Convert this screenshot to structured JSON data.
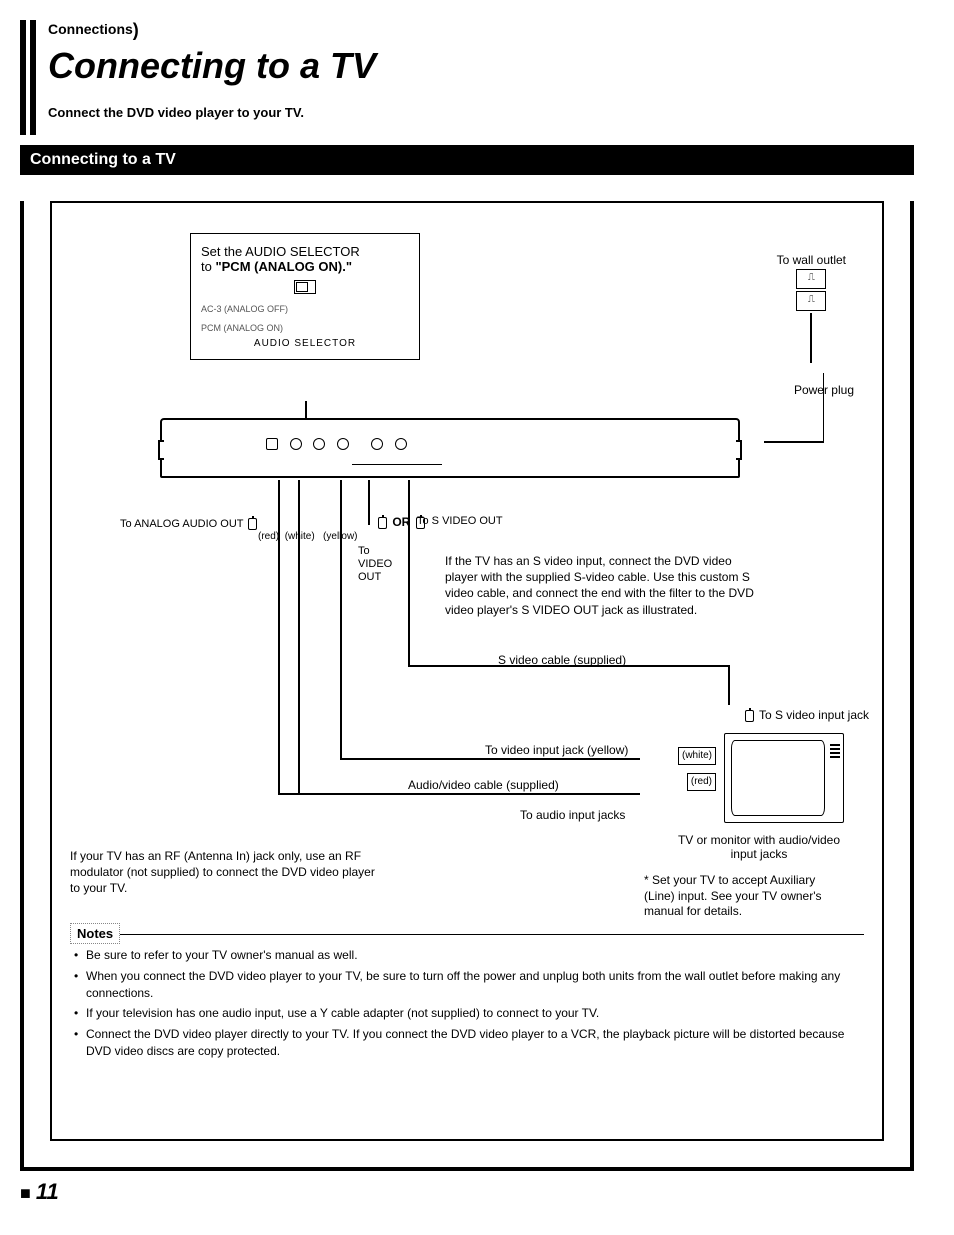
{
  "breadcrumb": "Connections",
  "title": "Connecting to a TV",
  "intro": "Connect the DVD video player to your TV.",
  "section_bar": "Connecting to a TV",
  "selector_box": {
    "line1": "Set the AUDIO SELECTOR",
    "line2_prefix": "to ",
    "line2_bold": "\"PCM (ANALOG ON).\"",
    "opt1": "AC-3 (ANALOG OFF)",
    "opt2": "PCM (ANALOG ON)",
    "label": "AUDIO SELECTOR"
  },
  "wall_outlet": "To wall outlet",
  "power_plug": "Power plug",
  "analog_out": "To ANALOG AUDIO OUT",
  "colors": {
    "red": "(red)",
    "white": "(white)",
    "yellow": "(yellow)"
  },
  "or": "OR",
  "svideo_out": "To S VIDEO OUT",
  "video_out": "To\nVIDEO\nOUT",
  "svideo_note": "If the TV has an S video input, connect the DVD video player with the supplied S-video cable. Use this custom S video cable, and connect the end with the filter to the DVD video player's S VIDEO OUT jack as illustrated.",
  "svideo_cable": "S video cable (supplied)",
  "svideo_jack": "To S video input jack",
  "video_jack": "To video input jack (yellow)",
  "av_cable": "Audio/video cable (supplied)",
  "audio_jack": "To audio input jacks",
  "tv_plugs": {
    "white": "(white)",
    "red": "(red)"
  },
  "tv_caption": "TV or monitor with audio/video input jacks",
  "tv_note": "* Set your TV to accept Auxiliary (Line) input. See your TV owner's manual for details.",
  "rf_note": "If your TV has an RF (Antenna In) jack only, use an RF modulator (not supplied) to connect the DVD video player to your TV.",
  "notes_header": "Notes",
  "notes": [
    "Be sure to refer to your TV owner's manual as well.",
    "When you connect the DVD video player to your TV, be sure to turn off the power and unplug both units from the wall outlet before making any connections.",
    "If your television has one audio input, use a Y cable adapter (not supplied) to connect to your TV.",
    "Connect the DVD video player directly to your TV. If you connect the DVD video player to a VCR, the playback picture will be distorted because DVD video discs are copy protected."
  ],
  "page_number": "11"
}
